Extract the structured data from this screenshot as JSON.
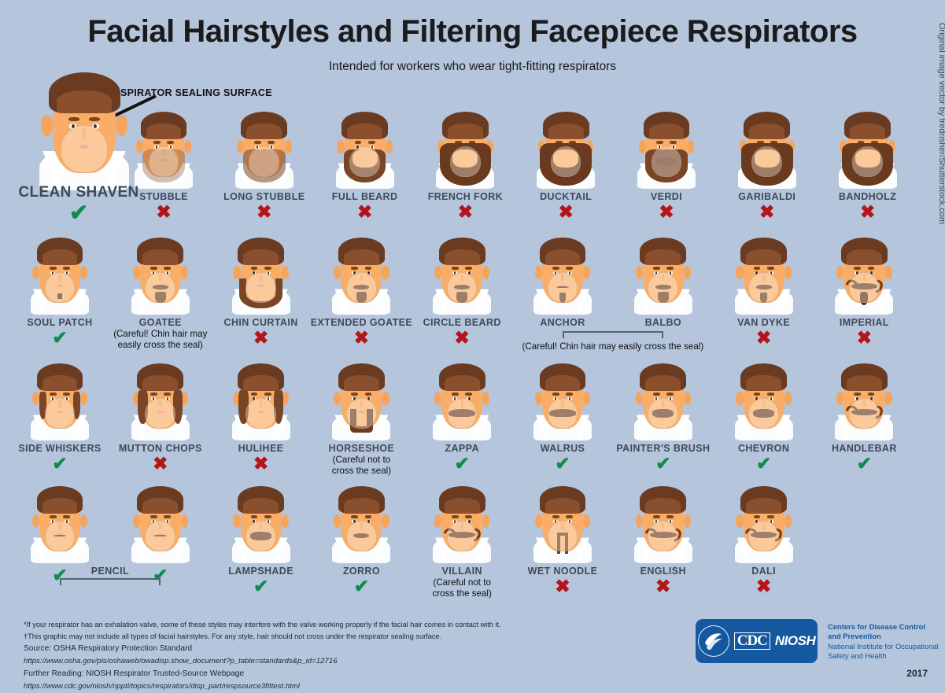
{
  "header": {
    "title": "Facial Hairstyles and Filtering Facepiece Respirators",
    "subtitle": "Intended for workers who wear tight-fitting respirators"
  },
  "callout": {
    "label": "RESPIRATOR SEALING SURFACE"
  },
  "marks": {
    "ok": "✔",
    "no": "✖"
  },
  "colors": {
    "background": "#b4c5dc",
    "approved": "#128a4e",
    "not_approved": "#b3161a",
    "label": "#3f4a56",
    "brand": "#14599f",
    "hair": "#6a3a21",
    "skin": "#f9ad66"
  },
  "featured": {
    "name": "CLEAN SHAVEN",
    "mark": "ok"
  },
  "rows": [
    {
      "items": [
        {
          "name": "STUBBLE",
          "mark": "no",
          "note": "",
          "style": "stubble"
        },
        {
          "name": "LONG STUBBLE",
          "mark": "no",
          "note": "",
          "style": "longstubble"
        },
        {
          "name": "FULL BEARD",
          "mark": "no",
          "note": "",
          "style": "fullbeard"
        },
        {
          "name": "FRENCH FORK",
          "mark": "no",
          "note": "",
          "style": "frenchfork"
        },
        {
          "name": "DUCKTAIL",
          "mark": "no",
          "note": "",
          "style": "ducktail"
        },
        {
          "name": "VERDI",
          "mark": "no",
          "note": "",
          "style": "verdi"
        },
        {
          "name": "GARIBALDI",
          "mark": "no",
          "note": "",
          "style": "garibaldi"
        },
        {
          "name": "BANDHOLZ",
          "mark": "no",
          "note": "",
          "style": "bandholz"
        }
      ]
    },
    {
      "items": [
        {
          "name": "SOUL PATCH",
          "mark": "ok",
          "note": "",
          "style": "soulpatch"
        },
        {
          "name": "GOATEE",
          "mark": "",
          "note": "(Careful! Chin hair may\neasily cross the seal)",
          "style": "goatee"
        },
        {
          "name": "CHIN CURTAIN",
          "mark": "no",
          "note": "",
          "style": "chincurtain"
        },
        {
          "name": "EXTENDED GOATEE",
          "mark": "no",
          "note": "",
          "style": "extendedgoatee"
        },
        {
          "name": "CIRCLE BEARD",
          "mark": "no",
          "note": "",
          "style": "circlebeard"
        },
        {
          "name": "ANCHOR",
          "mark": "",
          "note": "",
          "style": "anchor"
        },
        {
          "name": "BALBO",
          "mark": "",
          "note": "",
          "style": "balbo"
        },
        {
          "name": "VAN DYKE",
          "mark": "no",
          "note": "",
          "style": "vandyke"
        },
        {
          "name": "IMPERIAL",
          "mark": "no",
          "note": "",
          "style": "imperial"
        }
      ],
      "group_note": "(Careful! Chin hair may easily cross the seal)"
    },
    {
      "items": [
        {
          "name": "SIDE WHISKERS",
          "mark": "ok",
          "note": "",
          "style": "sidewhiskers"
        },
        {
          "name": "MUTTON CHOPS",
          "mark": "no",
          "note": "",
          "style": "muttonchops"
        },
        {
          "name": "HULIHEE",
          "mark": "no",
          "note": "",
          "style": "hulihee"
        },
        {
          "name": "HORSESHOE",
          "mark": "",
          "note": "(Careful not to\ncross the seal)",
          "style": "horseshoe"
        },
        {
          "name": "ZAPPA",
          "mark": "ok",
          "note": "",
          "style": "zappa"
        },
        {
          "name": "WALRUS",
          "mark": "ok",
          "note": "",
          "style": "walrus"
        },
        {
          "name": "PAINTER'S BRUSH",
          "mark": "ok",
          "note": "",
          "style": "paintersbrush"
        },
        {
          "name": "CHEVRON",
          "mark": "ok",
          "note": "",
          "style": "chevron"
        },
        {
          "name": "HANDLEBAR",
          "mark": "ok",
          "note": "",
          "style": "handlebar"
        }
      ]
    },
    {
      "items": [
        {
          "name": "",
          "mark": "ok",
          "note": "",
          "style": "pencil1"
        },
        {
          "name": "",
          "mark": "ok",
          "note": "",
          "style": "pencil2"
        },
        {
          "name": "LAMPSHADE",
          "mark": "ok",
          "note": "",
          "style": "lampshade"
        },
        {
          "name": "ZORRO",
          "mark": "ok",
          "note": "",
          "style": "zorro"
        },
        {
          "name": "VILLAIN",
          "mark": "",
          "note": "(Careful not to\ncross the seal)",
          "style": "villain"
        },
        {
          "name": "WET NOODLE",
          "mark": "no",
          "note": "",
          "style": "wetnoodle"
        },
        {
          "name": "ENGLISH",
          "mark": "no",
          "note": "",
          "style": "english"
        },
        {
          "name": "DALI",
          "mark": "no",
          "note": "",
          "style": "dali"
        }
      ],
      "group_label": "PENCIL"
    }
  ],
  "credit": "Original image vector by fredrisher/Shutterstock.com",
  "footnotes": {
    "line1": "*If your respirator has an exhalation valve, some of these styles may interfere with the valve working properly if the facial hair comes in contact with it.",
    "line2": "†This graphic may not include all types of facial hairstyles. For any style, hair should not cross under the respirator sealing surface.",
    "source": "Source: OSHA Respiratory Protection Standard",
    "source_url": "https://www.osha.gov/pls/oshaweb/owadisp.show_document?p_table=standards&p_id=12716",
    "further": "Further Reading: NIOSH Respirator Trusted-Source Webpage",
    "further_url": "https://www.cdc.gov/niosh/npptl/topics/respirators/disp_part/respsource3fittest.html"
  },
  "logo": {
    "cdc": "CDC",
    "niosh": "NIOSH",
    "agency_line1": "Centers for Disease Control",
    "agency_line2": "and Prevention",
    "agency_line3": "National Institute for Occupational",
    "agency_line4": "Safety and Health"
  },
  "year": "2017"
}
